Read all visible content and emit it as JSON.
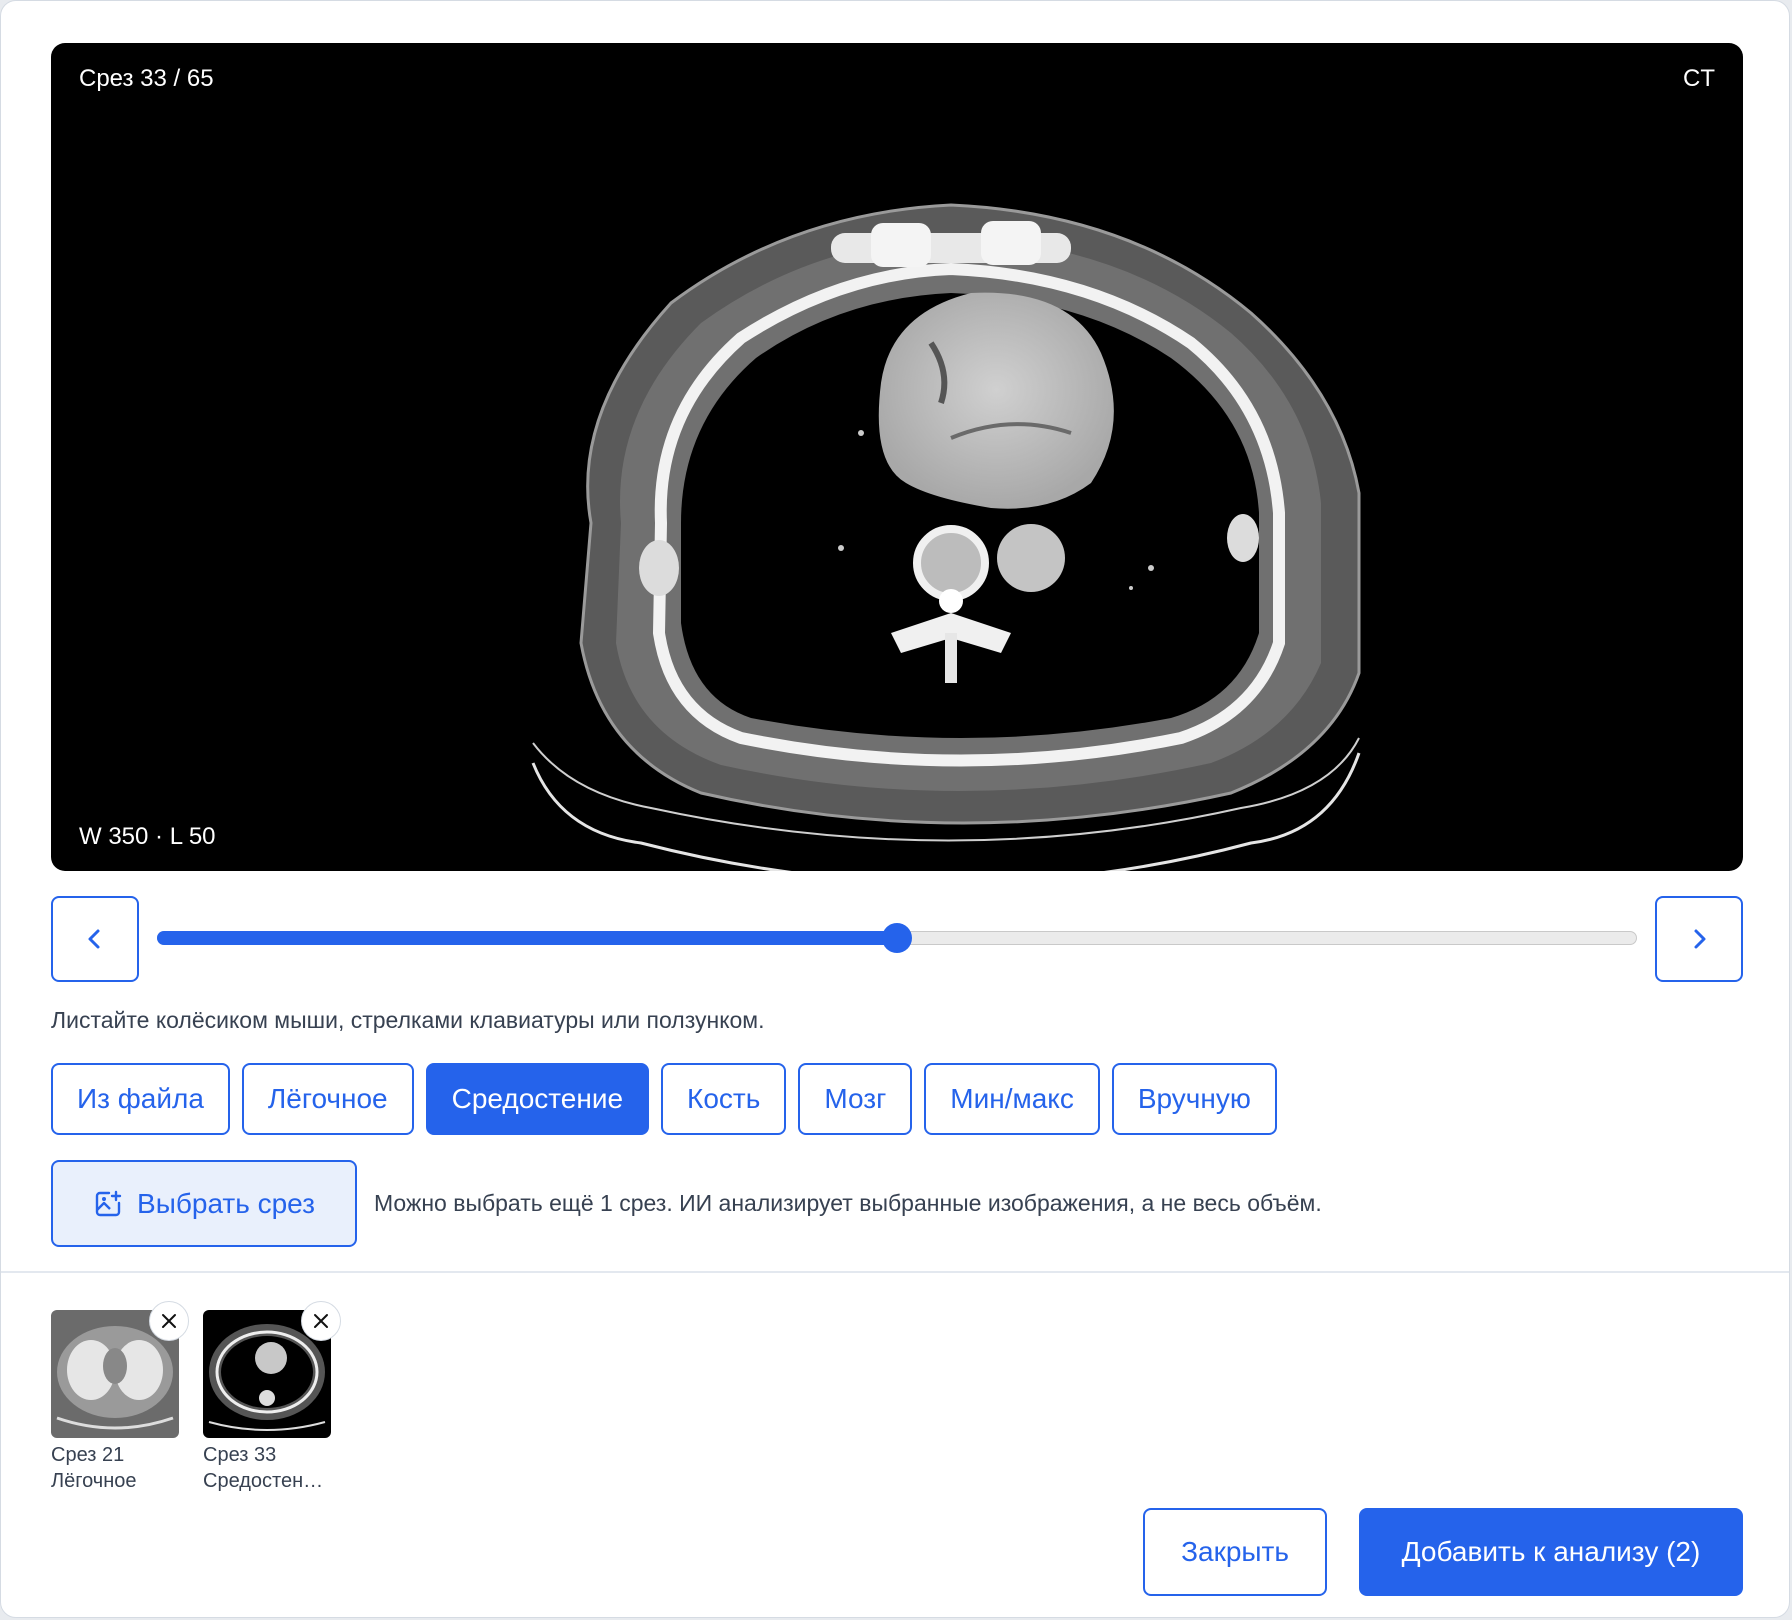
{
  "viewer": {
    "slice_label": "Срез 33 / 65",
    "modality": "CT",
    "window_label": "W 350 · L 50"
  },
  "slider": {
    "current": 33,
    "total": 65,
    "accent": "#2563eb"
  },
  "nav": {
    "prev_icon": "chevron-left-icon",
    "next_icon": "chevron-right-icon"
  },
  "hint": "Листайте колёсиком мыши, стрелками клавиатуры или ползунком.",
  "presets": [
    {
      "label": "Из файла",
      "active": false
    },
    {
      "label": "Лёгочное",
      "active": false
    },
    {
      "label": "Средостение",
      "active": true
    },
    {
      "label": "Кость",
      "active": false
    },
    {
      "label": "Мозг",
      "active": false
    },
    {
      "label": "Мин/макс",
      "active": false
    },
    {
      "label": "Вручную",
      "active": false
    }
  ],
  "select": {
    "label": "Выбрать срез",
    "icon": "image-add-icon",
    "note": "Можно выбрать ещё 1 срез. ИИ анализирует выбранные изображения, а не весь объём."
  },
  "thumbnails": [
    {
      "title": "Срез 21",
      "subtitle": "Лёгочное"
    },
    {
      "title": "Срез 33",
      "subtitle": "Средостен…"
    }
  ],
  "footer": {
    "close_label": "Закрыть",
    "add_label": "Добавить к анализу (2)"
  }
}
